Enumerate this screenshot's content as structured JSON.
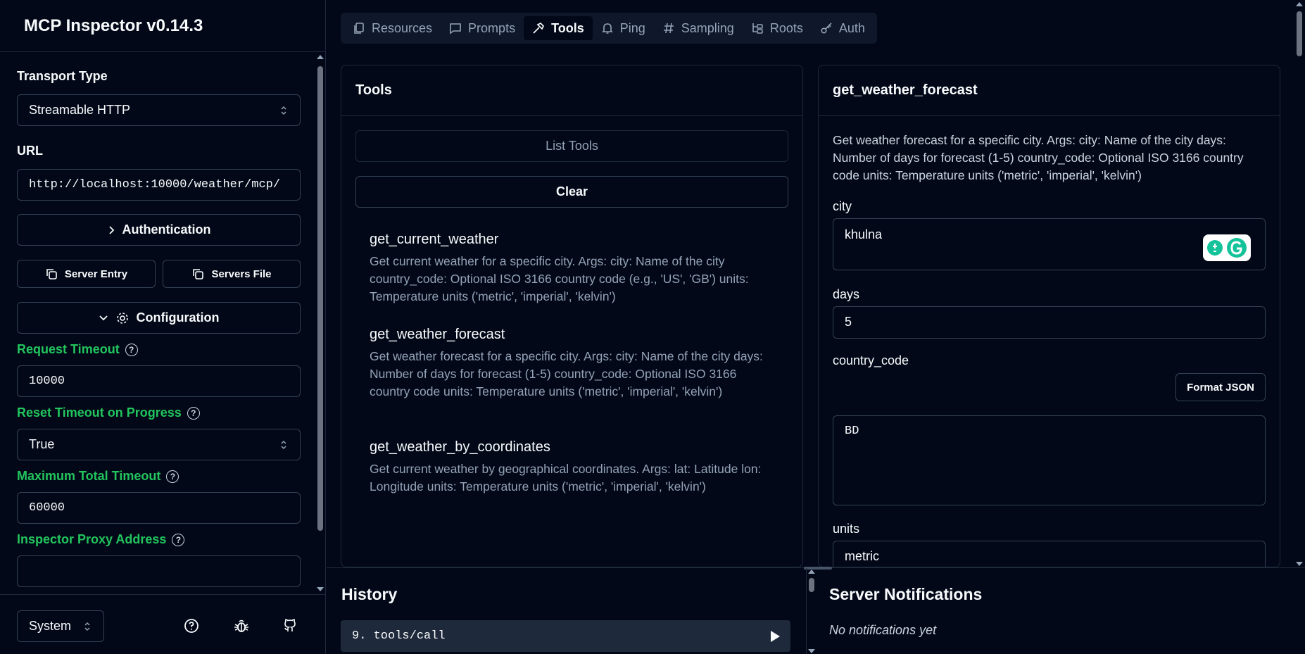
{
  "app": {
    "title": "MCP Inspector v0.14.3"
  },
  "sidebar": {
    "transport": {
      "label": "Transport Type",
      "value": "Streamable HTTP"
    },
    "url": {
      "label": "URL",
      "value": "http://localhost:10000/weather/mcp/"
    },
    "auth_label": "Authentication",
    "server_entry_label": "Server Entry",
    "servers_file_label": "Servers File",
    "configuration_label": "Configuration",
    "request_timeout": {
      "label": "Request Timeout",
      "value": "10000"
    },
    "reset_timeout": {
      "label": "Reset Timeout on Progress",
      "value": "True"
    },
    "max_timeout": {
      "label": "Maximum Total Timeout",
      "value": "60000"
    },
    "proxy": {
      "label": "Inspector Proxy Address",
      "value": ""
    },
    "theme": "System"
  },
  "tabs": [
    {
      "label": "Resources",
      "icon": "files-icon"
    },
    {
      "label": "Prompts",
      "icon": "message-icon"
    },
    {
      "label": "Tools",
      "icon": "hammer-icon",
      "active": true
    },
    {
      "label": "Ping",
      "icon": "bell-icon"
    },
    {
      "label": "Sampling",
      "icon": "hash-icon"
    },
    {
      "label": "Roots",
      "icon": "folder-tree-icon"
    },
    {
      "label": "Auth",
      "icon": "key-icon"
    }
  ],
  "tools_panel": {
    "title": "Tools",
    "list_tools_label": "List Tools",
    "clear_label": "Clear",
    "items": [
      {
        "name": "get_current_weather",
        "desc": "Get current weather for a specific city. Args: city: Name of the city country_code: Optional ISO 3166 country code (e.g., 'US', 'GB') units: Temperature units ('metric', 'imperial', 'kelvin')"
      },
      {
        "name": "get_weather_forecast",
        "desc": "Get weather forecast for a specific city. Args: city: Name of the city days: Number of days for forecast (1-5) country_code: Optional ISO 3166 country code units: Temperature units ('metric', 'imperial', 'kelvin')"
      },
      {
        "name": "get_weather_by_coordinates",
        "desc": "Get current weather by geographical coordinates. Args: lat: Latitude lon: Longitude units: Temperature units ('metric', 'imperial', 'kelvin')"
      }
    ]
  },
  "detail": {
    "title": "get_weather_forecast",
    "desc": "Get weather forecast for a specific city. Args: city: Name of the city days: Number of days for forecast (1-5) country_code: Optional ISO 3166 country code units: Temperature units ('metric', 'imperial', 'kelvin')",
    "city": {
      "label": "city",
      "value": "khulna"
    },
    "days": {
      "label": "days",
      "value": "5"
    },
    "country_code": {
      "label": "country_code",
      "value": "BD"
    },
    "format_json_label": "Format JSON",
    "units": {
      "label": "units",
      "value": "metric"
    }
  },
  "history": {
    "title": "History",
    "entry": "9. tools/call"
  },
  "notifications": {
    "title": "Server Notifications",
    "empty": "No notifications yet"
  },
  "colors": {
    "background": "#020817",
    "border": "#1e293b",
    "accent_green": "#22c55e",
    "muted": "#94a3b8"
  }
}
